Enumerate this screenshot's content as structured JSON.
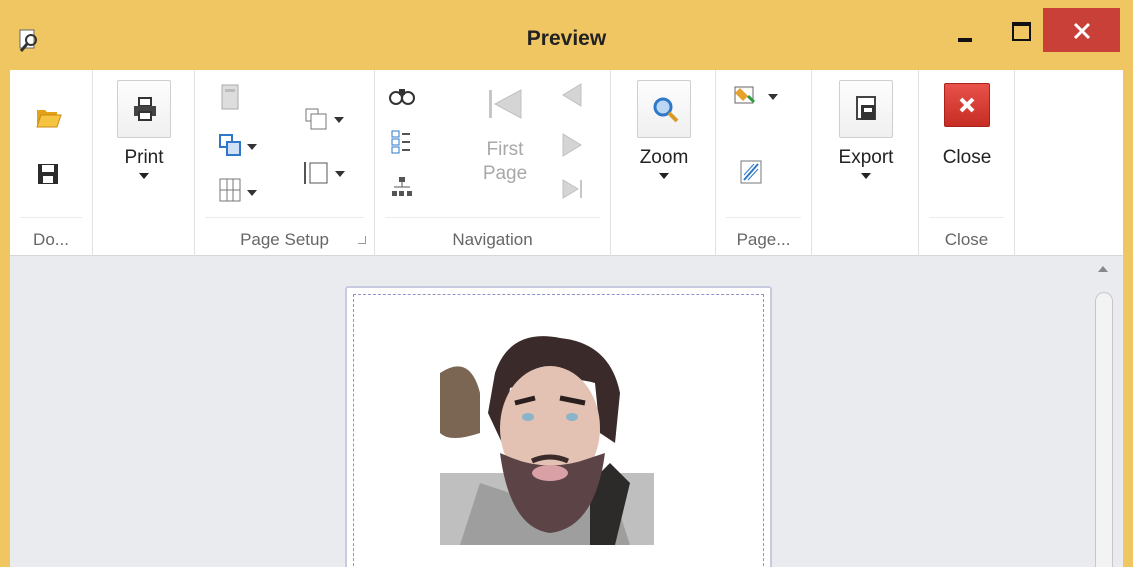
{
  "window": {
    "title": "Preview"
  },
  "ribbon": {
    "document": {
      "group_label": "Do..."
    },
    "print": {
      "label": "Print"
    },
    "page_setup": {
      "group_label": "Page Setup"
    },
    "navigation": {
      "group_label": "Navigation",
      "first_page_line1": "First",
      "first_page_line2": "Page"
    },
    "zoom": {
      "label": "Zoom"
    },
    "page_background": {
      "group_label": "Page..."
    },
    "export": {
      "label": "Export"
    },
    "close": {
      "label": "Close",
      "group_label": "Close"
    }
  },
  "colors": {
    "titlebar": "#f0c663",
    "close_button": "#c94039",
    "accent_blue": "#2f78c9"
  },
  "icons": [
    "open-folder-icon",
    "save-icon",
    "printer-icon",
    "find-icon",
    "zoom-icon",
    "export-icon",
    "close-icon"
  ]
}
